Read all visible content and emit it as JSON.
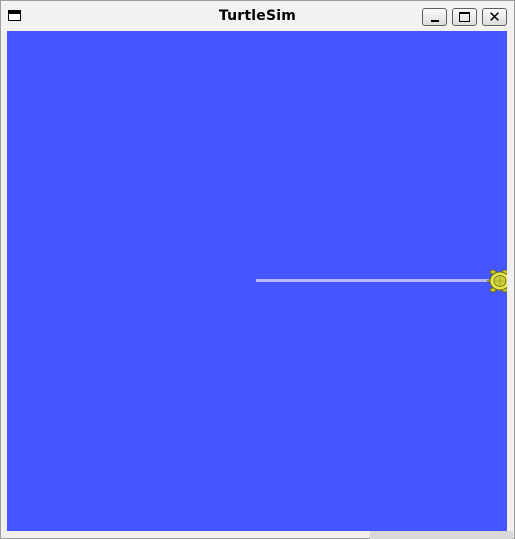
{
  "window": {
    "title": "TurtleSim",
    "controls": {
      "minimize": "_",
      "maximize": "□",
      "close": "✕"
    }
  },
  "canvas": {
    "background_color": "#4556ff",
    "pen_color": "#b3b8ff",
    "turtle_color": "#e3e34a",
    "turtle_icon": "turtle-icon"
  }
}
